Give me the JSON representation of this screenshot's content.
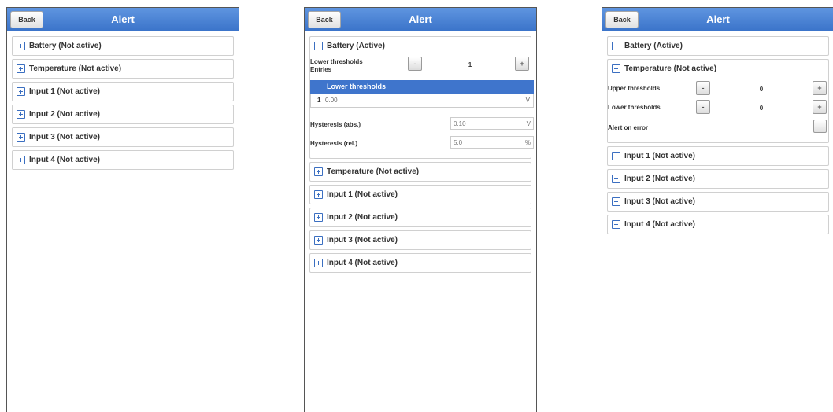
{
  "screens": [
    {
      "header": {
        "back_label": "Back",
        "title": "Alert"
      },
      "sections": [
        {
          "label": "Battery (Not active)"
        },
        {
          "label": "Temperature (Not active)"
        },
        {
          "label": "Input 1 (Not active)"
        },
        {
          "label": "Input 2 (Not active)"
        },
        {
          "label": "Input 3 (Not active)"
        },
        {
          "label": "Input 4 (Not active)"
        }
      ]
    },
    {
      "header": {
        "back_label": "Back",
        "title": "Alert"
      },
      "battery": {
        "label": "Battery (Active)",
        "lower_thresholds_label": "Lower thresholds",
        "entries_label": "Entries",
        "minus": "-",
        "plus": "+",
        "count": "1",
        "table_header": "Lower thresholds",
        "rows": [
          {
            "index": "1",
            "value": "0.00",
            "unit": "V"
          }
        ],
        "hyst_abs_label": "Hysteresis (abs.)",
        "hyst_abs_value": "0.10",
        "hyst_abs_unit": "V",
        "hyst_rel_label": "Hysteresis (rel.)",
        "hyst_rel_value": "5.0",
        "hyst_rel_unit": "%"
      },
      "sections": [
        {
          "label": "Temperature (Not active)"
        },
        {
          "label": "Input 1 (Not active)"
        },
        {
          "label": "Input 2 (Not active)"
        },
        {
          "label": "Input 3 (Not active)"
        },
        {
          "label": "Input 4 (Not active)"
        }
      ]
    },
    {
      "header": {
        "back_label": "Back",
        "title": "Alert"
      },
      "battery": {
        "label": "Battery (Active)"
      },
      "temperature": {
        "label": "Temperature (Not active)",
        "upper_label": "Upper thresholds",
        "upper_value": "0",
        "lower_label": "Lower thresholds",
        "lower_value": "0",
        "minus": "-",
        "plus": "+",
        "alert_on_error_label": "Alert on error"
      },
      "sections": [
        {
          "label": "Input 1 (Not active)"
        },
        {
          "label": "Input 2 (Not active)"
        },
        {
          "label": "Input 3 (Not active)"
        },
        {
          "label": "Input 4 (Not active)"
        }
      ]
    }
  ]
}
